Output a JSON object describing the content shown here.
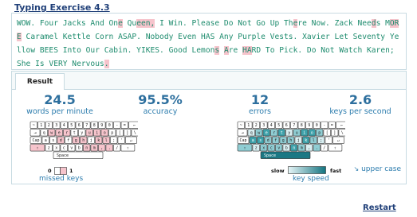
{
  "exercise_title": "Typing Exercise 4.3",
  "typed_segments": [
    {
      "t": "WOW. Four Jacks And On",
      "e": false
    },
    {
      "t": "e",
      "e": true
    },
    {
      "t": " Qu",
      "e": false
    },
    {
      "t": "een",
      "e": true
    },
    {
      "t": ",",
      "e": true
    },
    {
      "t": " I Win. Please Do Not Go Up Th",
      "e": false
    },
    {
      "t": "e",
      "e": true
    },
    {
      "t": "re Now. Zack Nee",
      "e": false
    },
    {
      "t": "d",
      "e": true
    },
    {
      "t": "s M",
      "e": false
    },
    {
      "t": "ORE",
      "e": true
    },
    {
      "t": " Caramel Kettle Corn ASAP. Nobody Even HAS Any Purple Vests. Xavier Let Seventy Yellow BEES Into Our Cabin. YIKES. Good Lemon",
      "e": false
    },
    {
      "t": "s",
      "e": true
    },
    {
      "t": " ",
      "e": false
    },
    {
      "t": "A",
      "e": true
    },
    {
      "t": "re ",
      "e": false
    },
    {
      "t": "HA",
      "e": true
    },
    {
      "t": "RD To Pick. Do Not Watch Karen; She Is VERY Nervous",
      "e": false
    },
    {
      "t": ".",
      "e": true
    }
  ],
  "tab_result": "Result",
  "stats": {
    "wpm_value": "24.5",
    "wpm_label": "words per minute",
    "accuracy_value": "95.5%",
    "accuracy_label": "accuracy",
    "errors_value": "12",
    "errors_label": "errors",
    "kps_value": "2.6",
    "kps_label": "keys per second"
  },
  "missed_keys": {
    "label": "missed keys",
    "scale_min": "0",
    "scale_max": "1",
    "missed": [
      "w",
      "e",
      "r",
      "u",
      "i",
      "o",
      "d",
      "g",
      "h",
      "k",
      "l",
      "n",
      "m",
      ",",
      ".",
      "shift-l"
    ]
  },
  "key_speed": {
    "label": "key speed",
    "slow": "slow",
    "fast": "fast",
    "speeds": {
      "q": 1,
      "w": 2,
      "e": 3,
      "r": 2,
      "t": 3,
      "y": 1,
      "u": 2,
      "i": 3,
      "o": 3,
      "p": 2,
      "a": 3,
      "s": 3,
      "d": 2,
      "f": 2,
      "g": 2,
      "h": 2,
      "j": 1,
      "k": 3,
      "l": 2,
      "z": 1,
      "x": 2,
      "c": 2,
      "v": 2,
      "b": 1,
      "n": 3,
      "m": 2,
      ",": 1,
      ".": 2,
      ";": 1,
      "space": 4,
      "shift-l": 2
    }
  },
  "keyboard_rows": [
    [
      "~",
      "1",
      "2",
      "3",
      "4",
      "5",
      "6",
      "7",
      "8",
      "9",
      "0",
      "-",
      "=",
      "←"
    ],
    [
      "⇥",
      "q",
      "w",
      "e",
      "r",
      "t",
      "y",
      "u",
      "i",
      "o",
      "p",
      "[",
      "]",
      "\\"
    ],
    [
      "Cap",
      "a",
      "s",
      "d",
      "f",
      "g",
      "h",
      "j",
      "k",
      "l",
      ";",
      "'",
      "↵"
    ],
    [
      "⇧",
      "z",
      "x",
      "c",
      "v",
      "b",
      "n",
      "m",
      ",",
      ".",
      "/",
      "⇧"
    ]
  ],
  "space_label": "Space",
  "upper_case_link": "upper case",
  "restart_link": "Restart",
  "colors": {
    "miss": "#f6c4cc",
    "accent": "#2d7dae",
    "title": "#1f3f78"
  }
}
